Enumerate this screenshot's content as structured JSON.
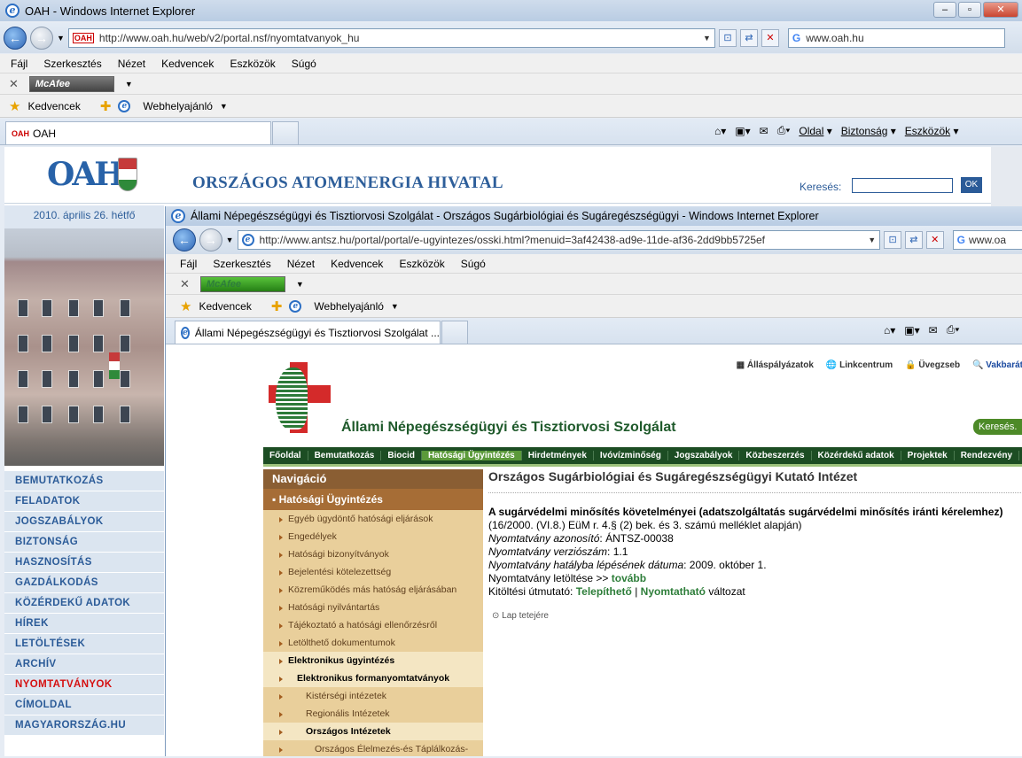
{
  "win1": {
    "title": "OAH - Windows Internet Explorer",
    "url": "http://www.oah.hu/web/v2/portal.nsf/nyomtatvanyok_hu",
    "url_domain": "oah.hu",
    "search_value": "www.oah.hu",
    "tab": "OAH",
    "fav_code": "OAH"
  },
  "menu": [
    "Fájl",
    "Szerkesztés",
    "Nézet",
    "Kedvencek",
    "Eszközök",
    "Súgó"
  ],
  "mcafee": "McAfee",
  "favbar": {
    "kedvencek": "Kedvencek",
    "webhely": "Webhelyajánló"
  },
  "cmd": {
    "oldal": "Oldal",
    "biztonsag": "Biztonság",
    "eszkozok": "Eszközök"
  },
  "oah": {
    "logo": "OAH",
    "title": "ORSZÁGOS ATOMENERGIA HIVATAL",
    "search_label": "Keresés:",
    "ok": "OK",
    "date": "2010. április 26. hétfő"
  },
  "sidemenu": [
    "BEMUTATKOZÁS",
    "FELADATOK",
    "JOGSZABÁLYOK",
    "BIZTONSÁG",
    "HASZNOSÍTÁS",
    "GAZDÁLKODÁS",
    "KÖZÉRDEKŰ ADATOK",
    "HÍREK",
    "LETÖLTÉSEK",
    "ARCHÍV",
    "NYOMTATVÁNYOK",
    "CÍMOLDAL",
    "MAGYARORSZÁG.HU"
  ],
  "win2": {
    "title": "Állami Népegészségügyi és Tisztiorvosi Szolgálat - Országos Sugárbiológiai és Sugáregészségügyi - Windows Internet Explorer",
    "url": "http://www.antsz.hu/portal/portal/e-ugyintezes/osski.html?menuid=3af42438-ad9e-11de-af36-2dd9bb5725ef",
    "url_domain": "antsz.hu",
    "search_value": "www.oa",
    "tab": "Állami Népegészségügyi és Tisztiorvosi Szolgálat ..."
  },
  "antsz": {
    "toplinks": [
      "Álláspályázatok",
      "Linkcentrum",
      "Üvegzseb",
      "Vakbarát"
    ],
    "title": "Állami Népegészségügyi és Tisztiorvosi Szolgálat",
    "search": "Keresés.",
    "nav": [
      "Főoldal",
      "Bemutatkozás",
      "Biocid",
      "Hatósági Ügyintézés",
      "Hirdetmények",
      "Ivóvízminőség",
      "Jogszabályok",
      "Közbeszerzés",
      "Közérdekű adatok",
      "Projektek",
      "Rendezvény"
    ],
    "leftnav_head": "Navigáció",
    "leftnav_sub": "Hatósági Ügyintézés",
    "leftnav": [
      "Egyéb ügydöntő hatósági eljárások",
      "Engedélyek",
      "Hatósági bizonyítványok",
      "Bejelentési kötelezettség",
      "Közreműködés más hatóság eljárásában",
      "Hatósági nyilvántartás",
      "Tájékoztató a hatósági ellenőrzésről",
      "Letölthető dokumentumok",
      "Elektronikus ügyintézés",
      "Elektronikus formanyomtatványok",
      "Kistérségi intézetek",
      "Regionális Intézetek",
      "Országos Intézetek",
      "Országos Élelmezés-és Táplálkozás-"
    ],
    "main_title": "Országos Sugárbiológiai és Sugáregészségügyi Kutató Intézet",
    "doc_title": "A sugárvédelmi minősítés követelményei (adatszolgáltatás sugárvédelmi minősítés iránti kérelemhez)",
    "doc_ref": "(16/2000. (VI.8.) EüM r. 4.§ (2) bek. és 3. számú melléklet alapján)",
    "id_label": "Nyomtatvány azonosító",
    "id_value": ": ÁNTSZ-00038",
    "ver_label": "Nyomtatvány verziószám",
    "ver_value": ": 1.1",
    "date_label": "Nyomtatvány hatályba lépésének dátuma",
    "date_value": ": 2009. október 1.",
    "dl_label": "Nyomtatvány letöltése   >>",
    "dl_link": "tovább",
    "guide_label": "Kitöltési útmutató:",
    "guide_link1": "Telepíthető",
    "guide_sep": "|",
    "guide_link2": "Nyomtatható",
    "guide_tail": "változat",
    "top": "Lap tetejére"
  }
}
